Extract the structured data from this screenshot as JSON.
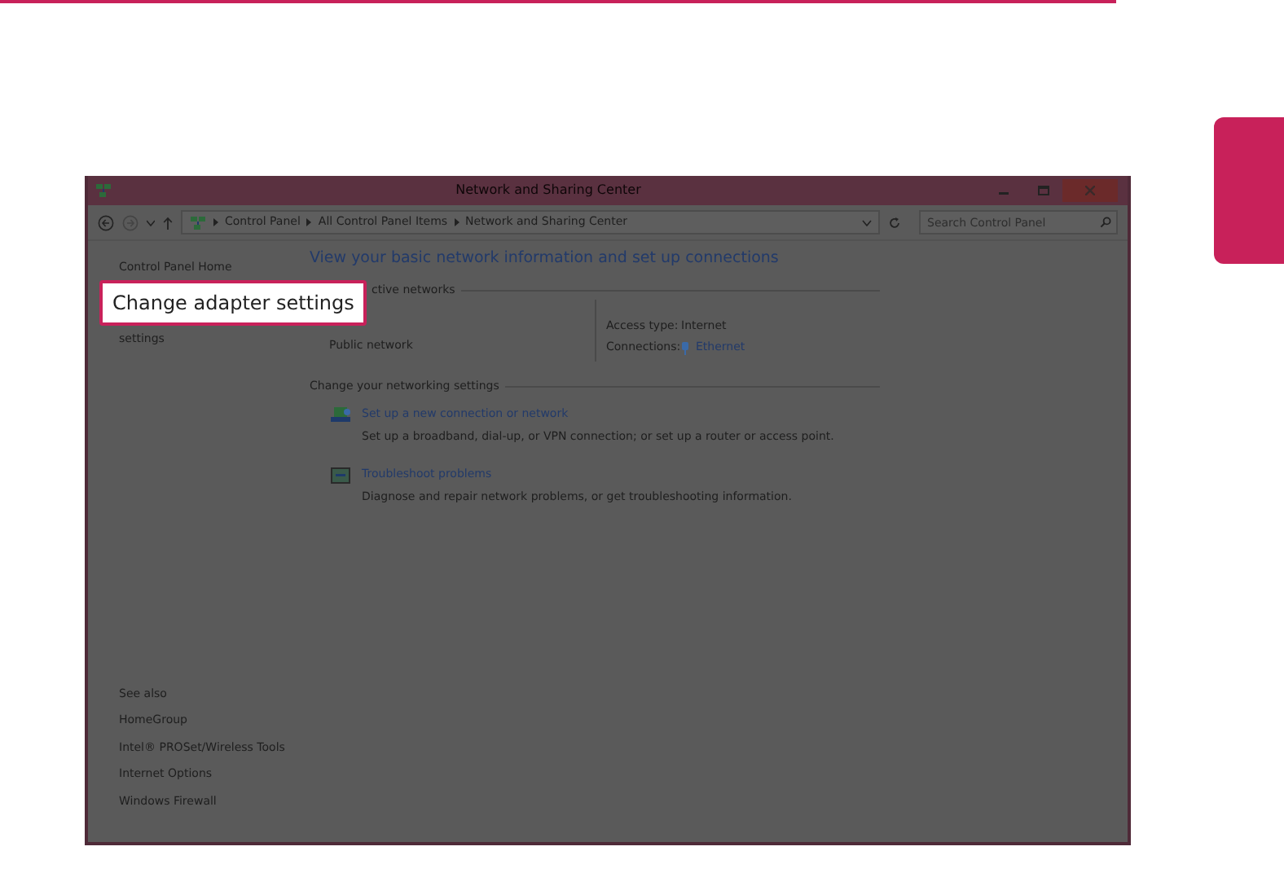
{
  "callout": {
    "label": "Change adapter settings"
  },
  "window": {
    "title": "Network and Sharing Center",
    "breadcrumb": [
      "Control Panel",
      "All Control Panel Items",
      "Network and Sharing Center"
    ],
    "search": {
      "placeholder": "Search Control Panel"
    },
    "sidebar": {
      "items": [
        "Control Panel Home",
        "settings"
      ],
      "see_also_heading": "See also",
      "see_also": [
        "HomeGroup",
        "Intel® PROSet/Wireless Tools",
        "Internet Options",
        "Windows Firewall"
      ]
    },
    "main": {
      "heading": "View your basic network information and set up connections",
      "active_networks": {
        "label": "ctive networks",
        "network_name": "Public network",
        "access_type_label": "Access type:",
        "access_type": "Internet",
        "connections_label": "Connections:",
        "connection": "Ethernet"
      },
      "settings_heading": "Change your networking settings",
      "tasks": [
        {
          "kind": "connection",
          "link": "Set up a new connection or network",
          "description": "Set up a broadband, dial-up, or VPN connection; or set up a router or access point."
        },
        {
          "kind": "troubleshoot",
          "link": "Troubleshoot problems",
          "description": "Diagnose and repair network problems, or get troubleshooting information."
        }
      ]
    }
  }
}
